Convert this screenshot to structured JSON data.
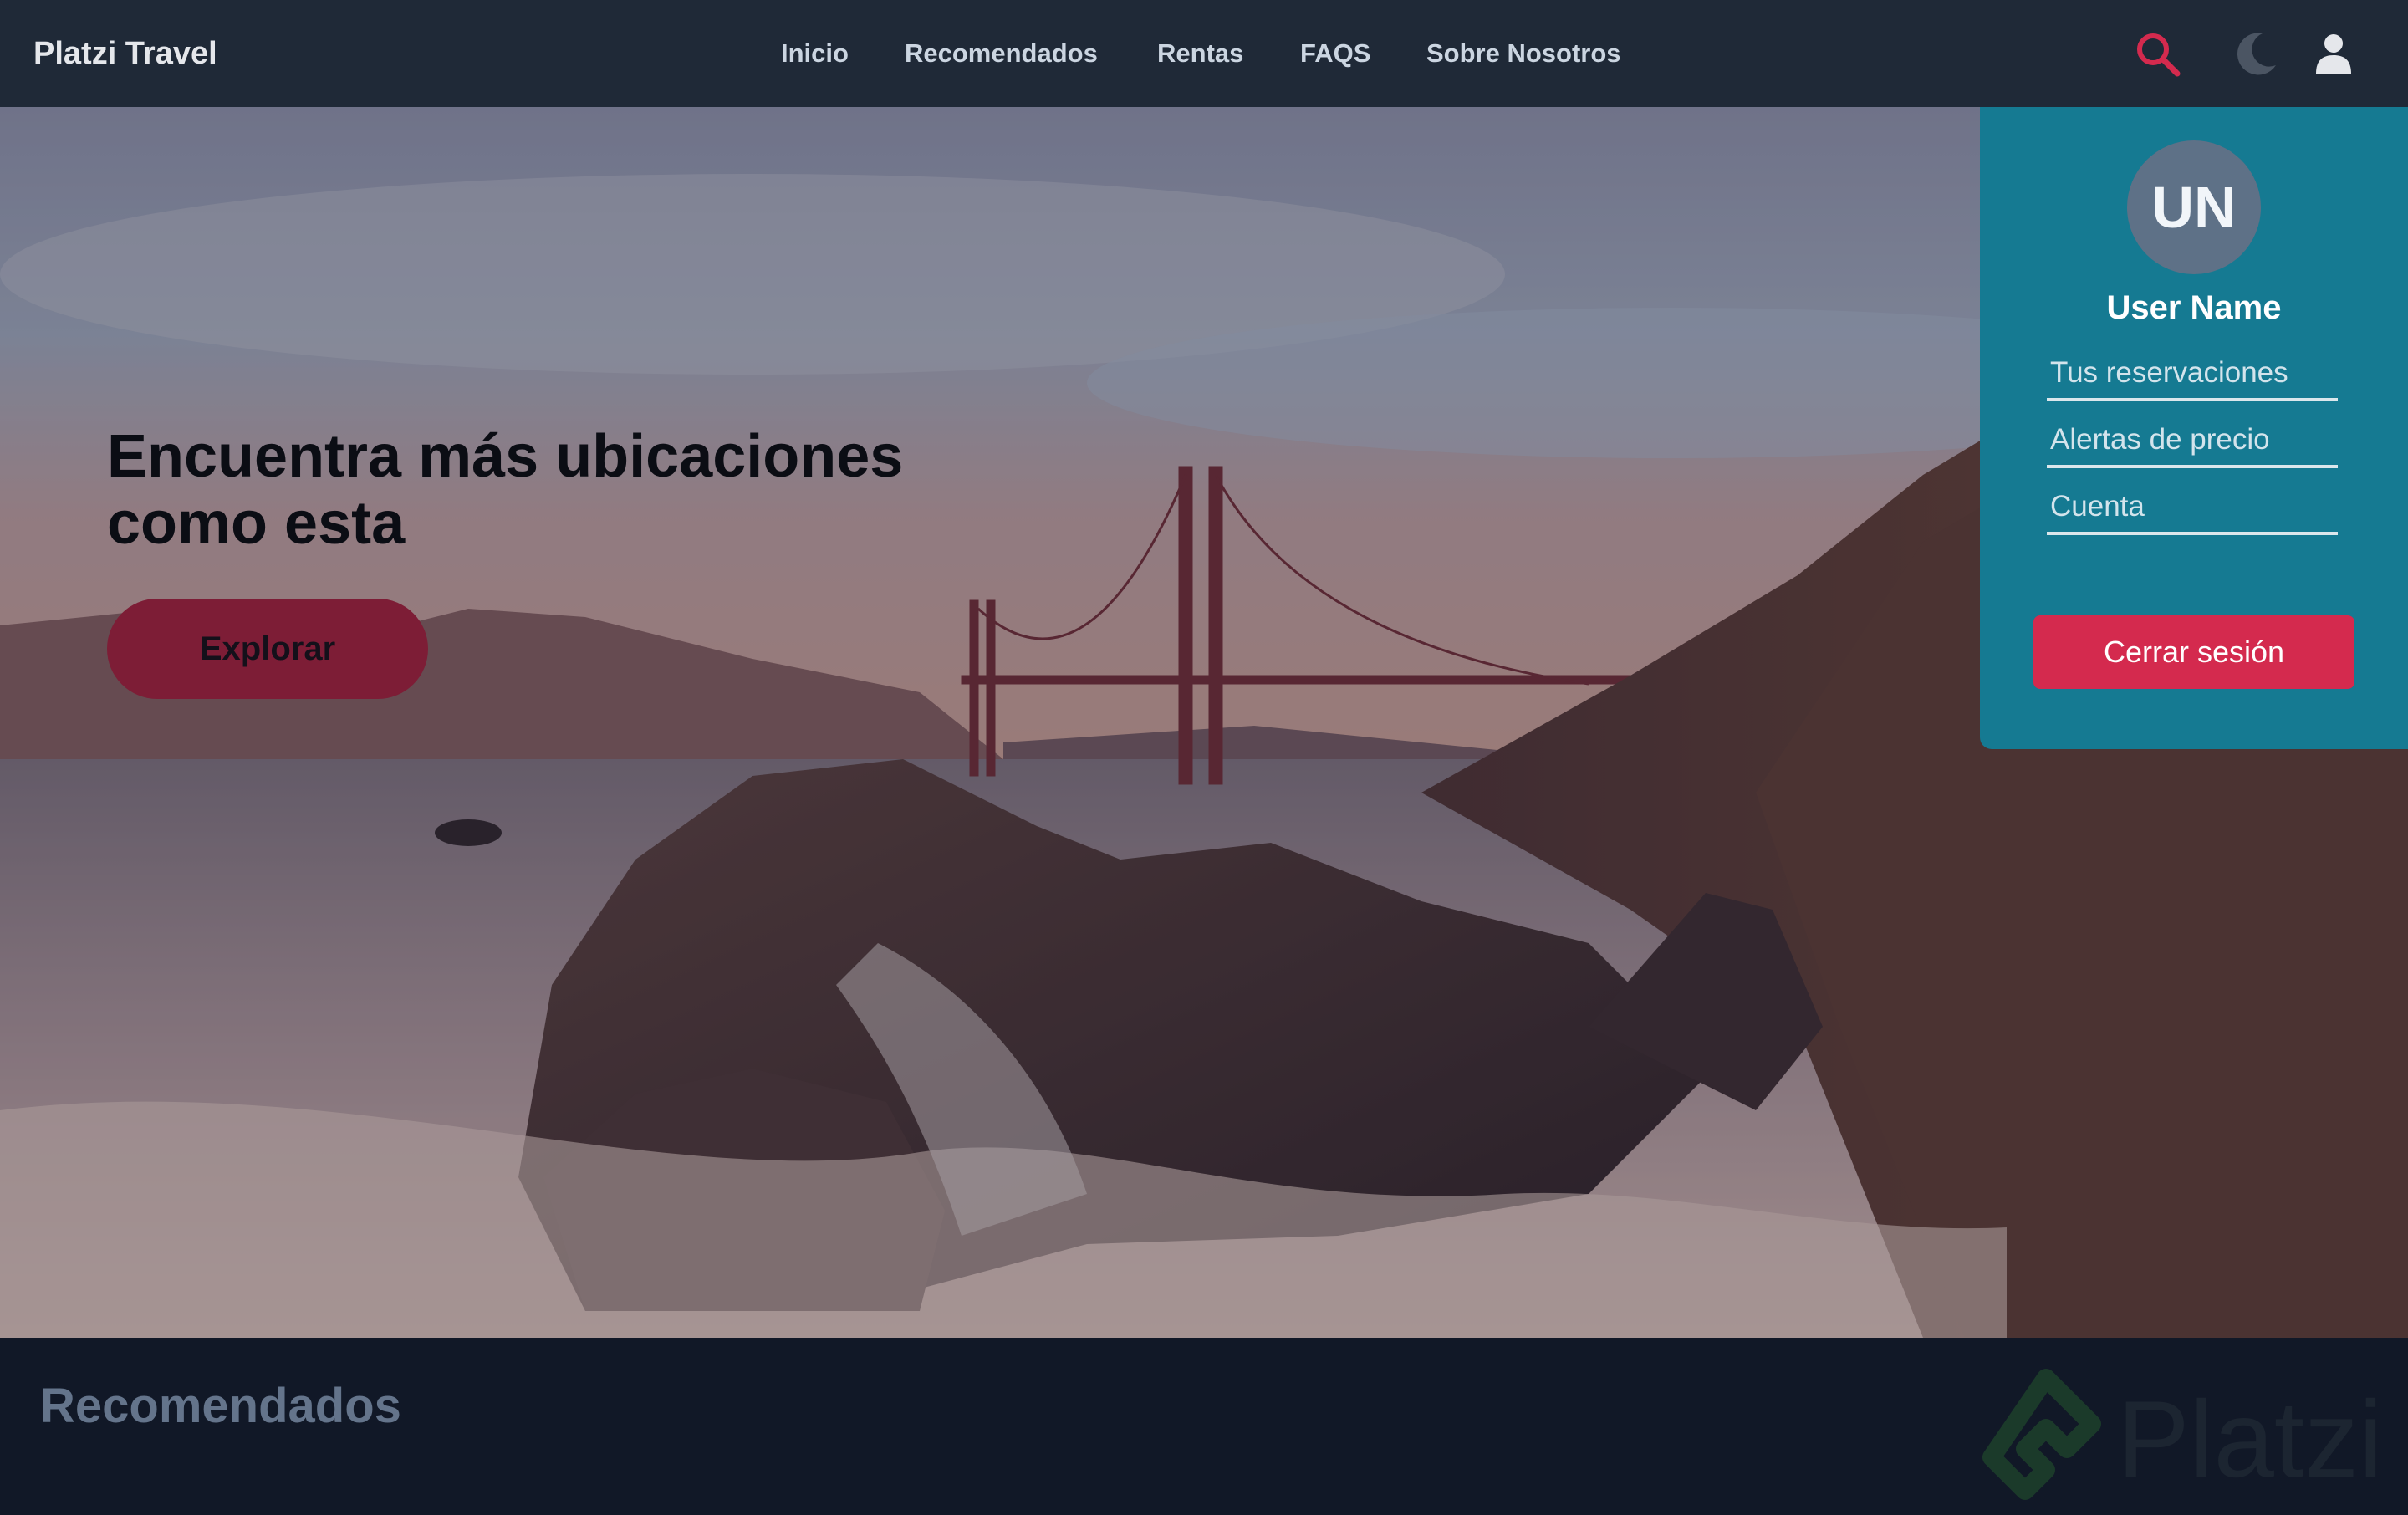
{
  "navbar": {
    "brand": "Platzi Travel",
    "links": [
      {
        "label": "Inicio"
      },
      {
        "label": "Recomendados"
      },
      {
        "label": "Rentas"
      },
      {
        "label": "FAQS"
      },
      {
        "label": "Sobre Nosotros"
      }
    ],
    "icons": {
      "search": "search-icon",
      "theme": "moon-icon",
      "user": "user-icon"
    },
    "accent_color": "#d42a4e"
  },
  "hero": {
    "title": "Encuentra más ubicaciones como esta",
    "cta_label": "Explorar"
  },
  "user_menu": {
    "initials": "UN",
    "name": "User Name",
    "items": [
      {
        "label": "Tus reservaciones"
      },
      {
        "label": "Alertas de precio"
      },
      {
        "label": "Cuenta"
      }
    ],
    "logout_label": "Cerrar sesión",
    "background_color": "#157a92"
  },
  "recommended": {
    "title": "Recomendados"
  },
  "watermark": {
    "text": "Platzi"
  }
}
